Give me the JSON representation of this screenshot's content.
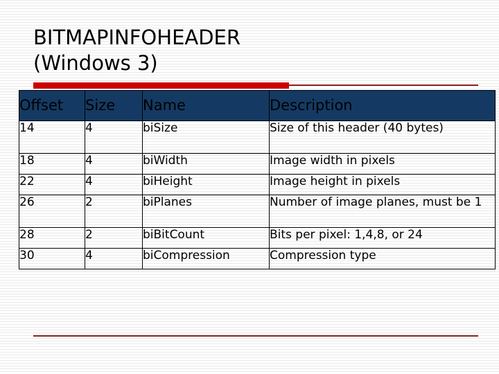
{
  "slide": {
    "title": "BITMAPINFOHEADER\n(Windows 3)",
    "accent_color": "#cc0000",
    "accent_thin_color": "#8e2020",
    "footer_rule_color": "#7d2525",
    "header_fill_color": "#143a63",
    "background_color": "#ffffff"
  },
  "table": {
    "columns": [
      {
        "key": "offset",
        "label": "Offset"
      },
      {
        "key": "size",
        "label": "Size"
      },
      {
        "key": "name",
        "label": "Name"
      },
      {
        "key": "description",
        "label": "Description"
      }
    ],
    "rows": [
      {
        "offset": "14",
        "size": "4",
        "name": "biSize",
        "description": "Size of this header (40 bytes)"
      },
      {
        "offset": "18",
        "size": "4",
        "name": "biWidth",
        "description": "Image width in pixels"
      },
      {
        "offset": "22",
        "size": "4",
        "name": "biHeight",
        "description": "Image height in pixels"
      },
      {
        "offset": "26",
        "size": "2",
        "name": "biPlanes",
        "description": "Number of image planes, must be 1"
      },
      {
        "offset": "28",
        "size": "2",
        "name": "biBitCount",
        "description": "Bits per pixel: 1,4,8, or 24"
      },
      {
        "offset": "30",
        "size": "4",
        "name": "biCompression",
        "description": "Compression type"
      }
    ]
  }
}
